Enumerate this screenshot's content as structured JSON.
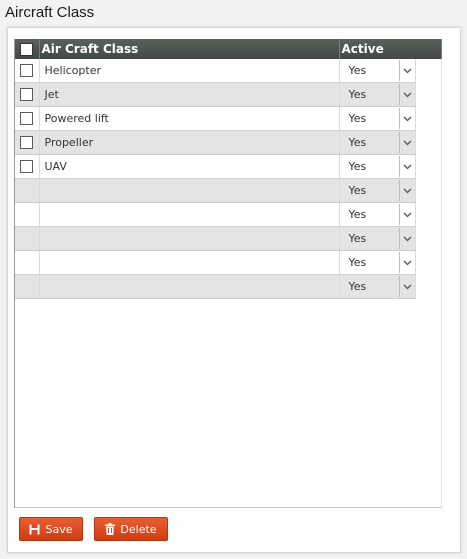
{
  "page": {
    "title": "Aircraft Class"
  },
  "grid": {
    "columns": {
      "name": "Air Craft Class",
      "active": "Active"
    },
    "rows": [
      {
        "name": "Helicopter",
        "active": "Yes"
      },
      {
        "name": "Jet",
        "active": "Yes"
      },
      {
        "name": "Powered lift",
        "active": "Yes"
      },
      {
        "name": "Propeller",
        "active": "Yes"
      },
      {
        "name": "UAV",
        "active": "Yes"
      },
      {
        "name": "",
        "active": "Yes"
      },
      {
        "name": "",
        "active": "Yes"
      },
      {
        "name": "",
        "active": "Yes"
      },
      {
        "name": "",
        "active": "Yes"
      },
      {
        "name": "",
        "active": "Yes"
      }
    ]
  },
  "actions": {
    "save_label": "Save",
    "delete_label": "Delete"
  },
  "icons": {
    "save": "floppy-disk-icon",
    "delete": "trash-icon",
    "dropdown": "chevron-down-icon"
  },
  "colors": {
    "header_bg": "#4a4f4b",
    "button_bg": "#dd4b22",
    "row_alt": "#e4e4e4"
  }
}
